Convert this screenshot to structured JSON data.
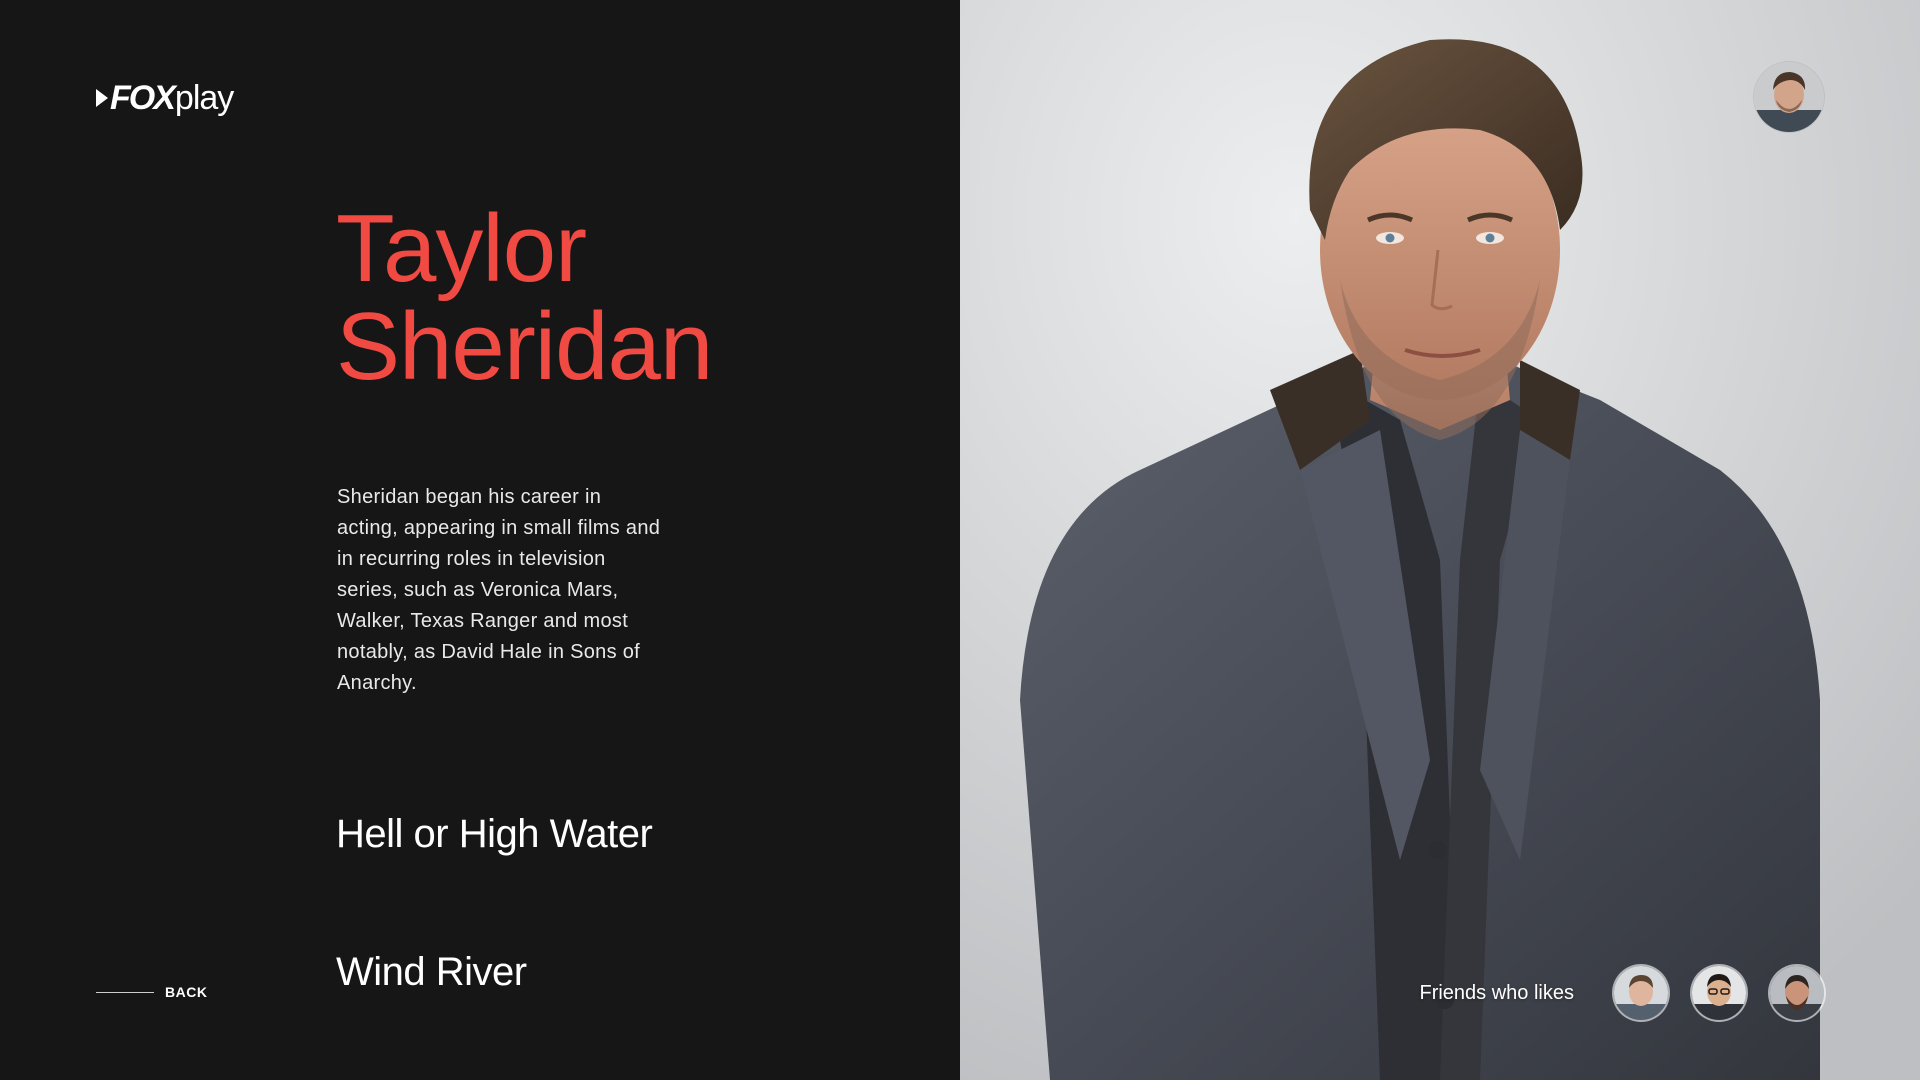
{
  "brand": {
    "logo_fox": "FOX",
    "logo_play": "play"
  },
  "person": {
    "name_line1": "Taylor",
    "name_line2": "Sheridan",
    "bio": "Sheridan began his career in acting, appearing in small films and in recurring roles in television series, such as Veronica Mars, Walker, Texas Ranger and most notably, as David Hale in Sons of Anarchy."
  },
  "films": [
    {
      "title": "Hell or High Water"
    },
    {
      "title": "Wind River"
    }
  ],
  "nav": {
    "back_label": "BACK"
  },
  "friends": {
    "label": "Friends who likes",
    "count": 3
  },
  "colors": {
    "background": "#161617",
    "accent": "#f04a43",
    "text": "#ffffff"
  },
  "icons": {
    "logo_play": "play-triangle-icon",
    "user": "user-avatar",
    "back": "back-line-icon"
  }
}
